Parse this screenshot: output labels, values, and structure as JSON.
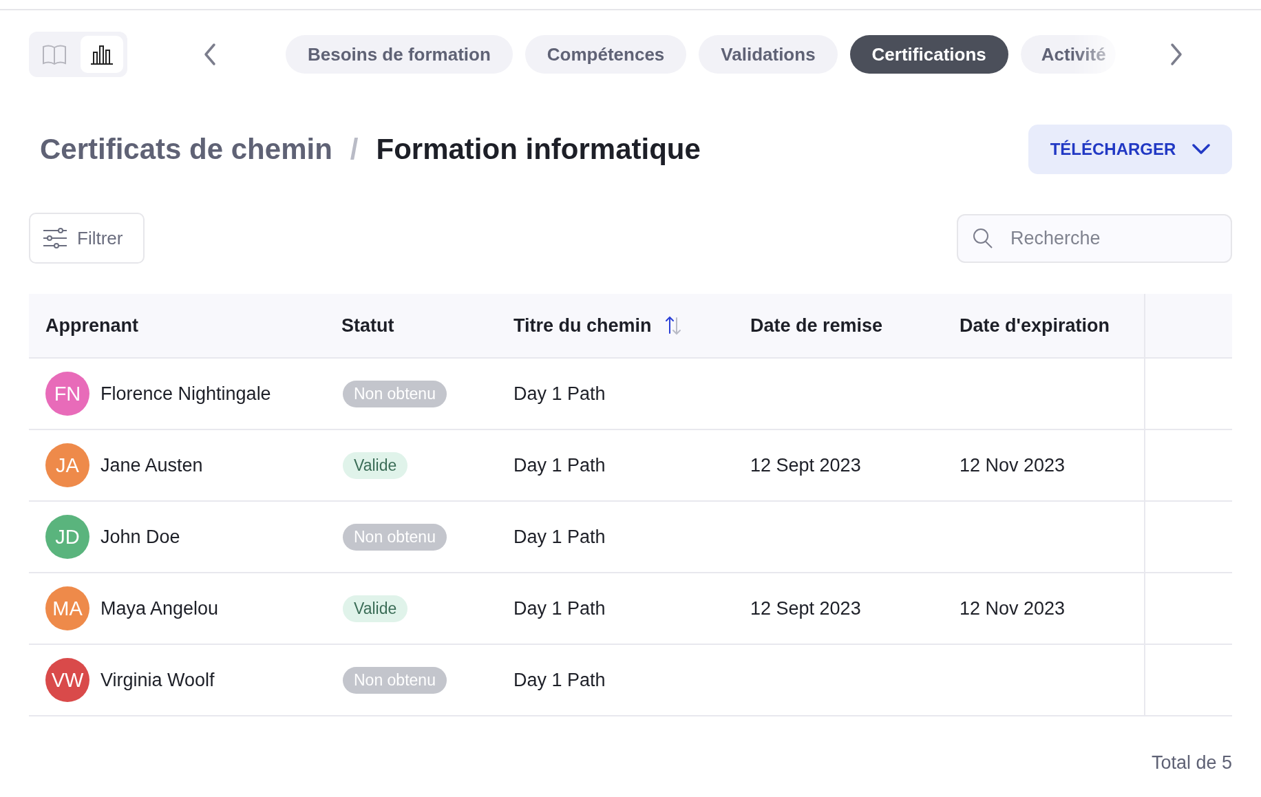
{
  "view_toggle": [
    {
      "kind": "book",
      "selected": false
    },
    {
      "kind": "chart",
      "selected": true
    }
  ],
  "tabs": [
    {
      "label": "Besoins de formation",
      "selected": false
    },
    {
      "label": "Compétences",
      "selected": false
    },
    {
      "label": "Validations",
      "selected": false
    },
    {
      "label": "Certifications",
      "selected": true
    },
    {
      "label": "Activité",
      "selected": false
    }
  ],
  "breadcrumb": {
    "parent": "Certificats de chemin",
    "separator": "/",
    "current": "Formation informatique"
  },
  "download_button": "TÉLÉCHARGER",
  "filter_button": "Filtrer",
  "search": {
    "placeholder": "Recherche"
  },
  "table": {
    "columns": [
      {
        "label": "Apprenant"
      },
      {
        "label": "Statut"
      },
      {
        "label": "Titre du chemin",
        "sorted_ascending": true
      },
      {
        "label": "Date de remise"
      },
      {
        "label": "Date d'expiration"
      }
    ],
    "rows": [
      {
        "initials": "FN",
        "color": "#e86bb9",
        "name": "Florence Nightingale",
        "status": {
          "kind": "not_obtained",
          "label": "Non obtenu"
        },
        "path": "Day 1 Path"
      },
      {
        "initials": "JA",
        "color": "#ee8a4a",
        "name": "Jane Austen",
        "status": {
          "kind": "valid",
          "label": "Valide"
        },
        "path": "Day 1 Path",
        "issued": "12 Sept 2023",
        "expires": "12 Nov 2023"
      },
      {
        "initials": "JD",
        "color": "#5ab47d",
        "name": "John Doe",
        "status": {
          "kind": "not_obtained",
          "label": "Non obtenu"
        },
        "path": "Day 1 Path"
      },
      {
        "initials": "MA",
        "color": "#ee8a4a",
        "name": "Maya Angelou",
        "status": {
          "kind": "valid",
          "label": "Valide"
        },
        "path": "Day 1 Path",
        "issued": "12 Sept 2023",
        "expires": "12 Nov 2023"
      },
      {
        "initials": "VW",
        "color": "#d94a4a",
        "name": "Virginia Woolf",
        "status": {
          "kind": "not_obtained",
          "label": "Non obtenu"
        },
        "path": "Day 1 Path"
      }
    ]
  },
  "total": "Total de 5"
}
